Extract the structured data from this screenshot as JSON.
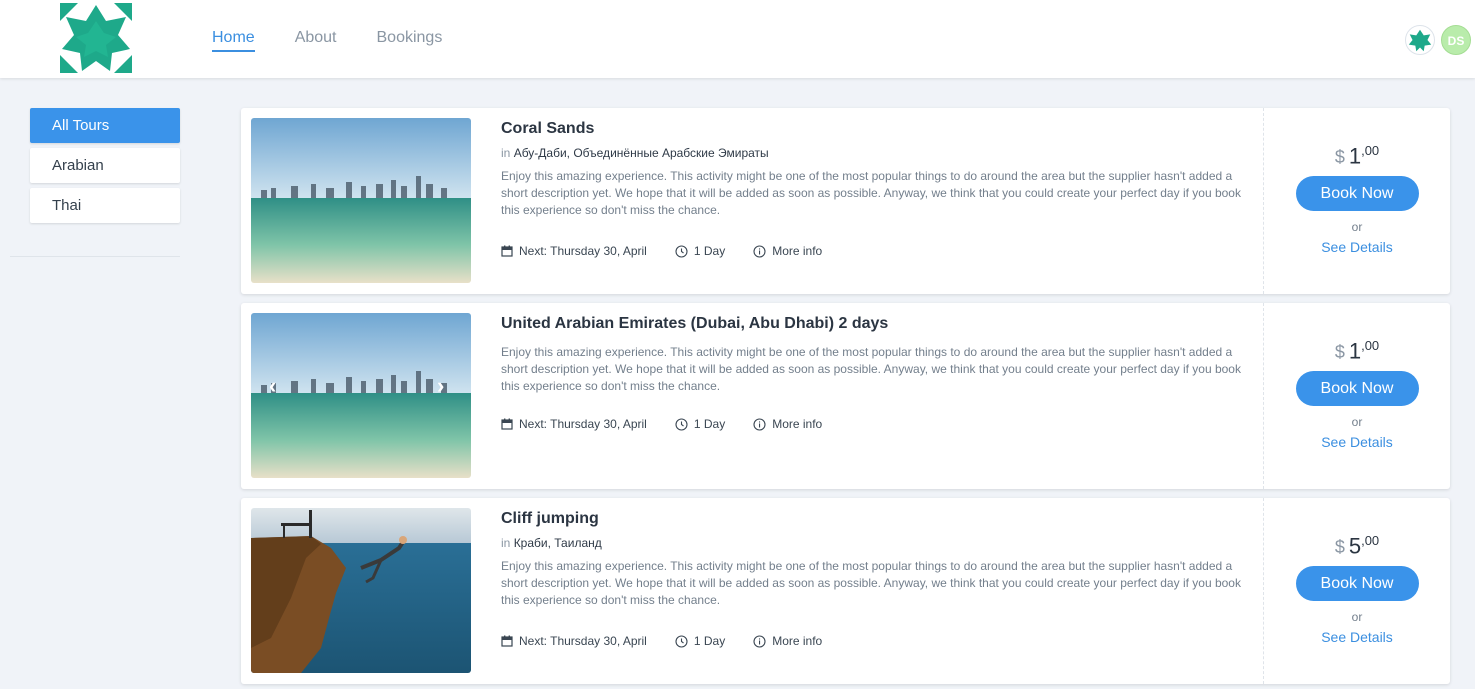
{
  "nav": {
    "home": "Home",
    "about": "About",
    "bookings": "Bookings"
  },
  "user": {
    "initials": "DS"
  },
  "filters": [
    "All Tours",
    "Arabian",
    "Thai"
  ],
  "tours": [
    {
      "title": "Coral Sands",
      "in_label": "in",
      "location": "Абу-Даби, Объединённые Арабские Эмираты",
      "description": "Enjoy this amazing experience. This activity might be one of the most popular things to do around the area but the supplier hasn't added a short description yet. We hope that it will be added as soon as possible. Anyway, we think that you could create your perfect day if you book this experience so don't miss the chance.",
      "next": "Next: Thursday 30, April",
      "duration": "1 Day",
      "more_info": "More info",
      "currency": "$",
      "price_int": "1",
      "price_dec": ",00",
      "book": "Book Now",
      "or": "or",
      "details": "See Details"
    },
    {
      "title": "United Arabian Emirates (Dubai, Abu Dhabi) 2 days",
      "description": "Enjoy this amazing experience. This activity might be one of the most popular things to do around the area but the supplier hasn't added a short description yet. We hope that it will be added as soon as possible. Anyway, we think that you could create your perfect day if you book this experience so don't miss the chance.",
      "next": "Next: Thursday 30, April",
      "duration": "1 Day",
      "more_info": "More info",
      "currency": "$",
      "price_int": "1",
      "price_dec": ",00",
      "book": "Book Now",
      "or": "or",
      "details": "See Details"
    },
    {
      "title": "Cliff jumping",
      "in_label": "in",
      "location": "Краби, Таиланд",
      "description": "Enjoy this amazing experience. This activity might be one of the most popular things to do around the area but the supplier hasn't added a short description yet. We hope that it will be added as soon as possible. Anyway, we think that you could create your perfect day if you book this experience so don't miss the chance.",
      "next": "Next: Thursday 30, April",
      "duration": "1 Day",
      "more_info": "More info",
      "currency": "$",
      "price_int": "5",
      "price_dec": ",00",
      "book": "Book Now",
      "or": "or",
      "details": "See Details"
    }
  ],
  "colors": {
    "accent": "#3a93ea",
    "brand": "#1ea98a",
    "background": "#f0f3f8"
  }
}
